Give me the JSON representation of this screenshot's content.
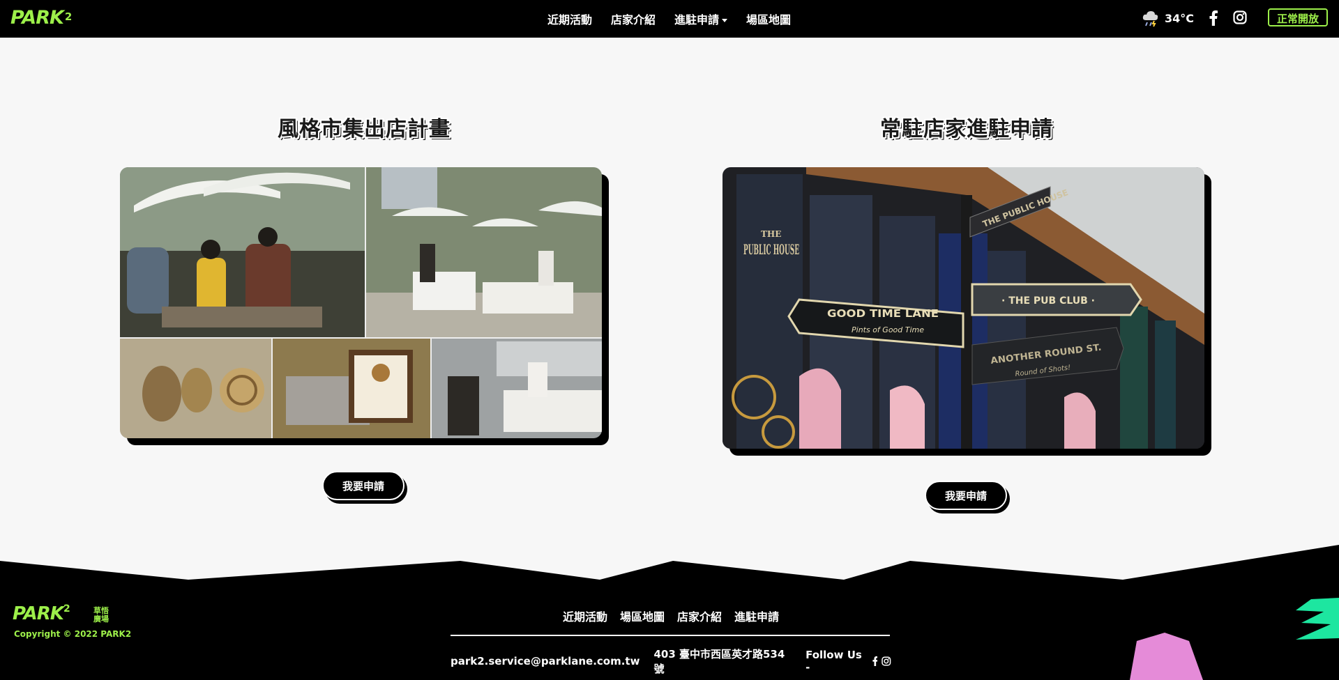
{
  "header": {
    "logo": "PARK",
    "logo_sup": "2",
    "nav": [
      "近期活動",
      "店家介紹",
      "進駐申請",
      "場區地圖"
    ],
    "temperature": "34°C",
    "status": "正常開放"
  },
  "cards": [
    {
      "title": "風格市集出店計畫",
      "button": "我要申請"
    },
    {
      "title": "常駐店家進駐申請",
      "button": "我要申請"
    }
  ],
  "signs": {
    "public_house_top": "THE",
    "public_house": "PUBLIC HOUSE",
    "good_time": "GOOD TIME LANE",
    "good_time_sub": "Pints of Good Time",
    "pub_club": "· THE PUB CLUB ·",
    "another_round": "ANOTHER ROUND ST.",
    "another_round_sub": "Round of Shots!",
    "public_house_sign": "THE PUBLIC HOUSE"
  },
  "footer": {
    "logo": "PARK",
    "logo_sup": "2",
    "logo_side": "草悟廣場",
    "copyright": "Copyright © 2022 PARK2",
    "nav": [
      "近期活動",
      "場區地圖",
      "店家介紹",
      "進駐申請"
    ],
    "email": "park2.service@parklane.com.tw",
    "address": "403 臺中市西區英才路534號",
    "follow": "Follow Us -"
  },
  "colors": {
    "accent": "#9df04a",
    "teal": "#1de6a0",
    "pink": "#e58bd8"
  }
}
